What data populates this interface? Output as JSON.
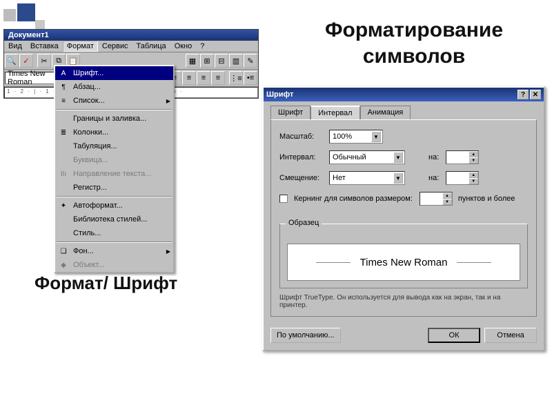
{
  "headings": {
    "title_line1": "Форматирование",
    "title_line2": "символов",
    "path": "Формат/ Шрифт"
  },
  "app": {
    "title": "Документ1",
    "menus": [
      "Вид",
      "Вставка",
      "Формат",
      "Сервис",
      "Таблица",
      "Окно",
      "?"
    ],
    "font_name": "Times New Roman",
    "ruler": "1 · 2 · | · 1 · | · 2 · | · 3 · | · 4 · | · 5 · | · 6 ·",
    "dropdown": {
      "items": [
        {
          "icon": "A",
          "label": "Шрифт...",
          "selected": true
        },
        {
          "icon": "¶",
          "label": "Абзац..."
        },
        {
          "icon": "≡",
          "label": "Список...",
          "arrow": true
        },
        {
          "sep": true
        },
        {
          "icon": "",
          "label": "Границы и заливка..."
        },
        {
          "icon": "≣",
          "label": "Колонки..."
        },
        {
          "icon": "",
          "label": "Табуляция..."
        },
        {
          "icon": "",
          "label": "Буквица...",
          "disabled": true
        },
        {
          "icon": "IIı",
          "label": "Направление текста...",
          "disabled": true
        },
        {
          "icon": "",
          "label": "Регистр..."
        },
        {
          "sep": true
        },
        {
          "icon": "✦",
          "label": "Автоформат..."
        },
        {
          "icon": "",
          "label": "Библиотека стилей..."
        },
        {
          "icon": "",
          "label": "Стиль..."
        },
        {
          "sep": true
        },
        {
          "icon": "❏",
          "label": "Фон...",
          "arrow": true
        },
        {
          "icon": "◆",
          "label": "Объект...",
          "disabled": true
        }
      ]
    }
  },
  "dialog": {
    "title": "Шрифт",
    "tabs": [
      "Шрифт",
      "Интервал",
      "Анимация"
    ],
    "active_tab": 1,
    "scale_label": "Масштаб:",
    "scale_value": "100%",
    "spacing_label": "Интервал:",
    "spacing_value": "Обычный",
    "na1": "на:",
    "position_label": "Смещение:",
    "position_value": "Нет",
    "na2": "на:",
    "kerning_label": "Кернинг для символов размером:",
    "kerning_suffix": "пунктов и более",
    "sample_label": "Образец",
    "sample_text": "Times New Roman",
    "hint": "Шрифт TrueType. Он используется для вывода как на экран, так и на принтер.",
    "btn_default": "По умолчанию...",
    "btn_ok": "ОК",
    "btn_cancel": "Отмена"
  }
}
